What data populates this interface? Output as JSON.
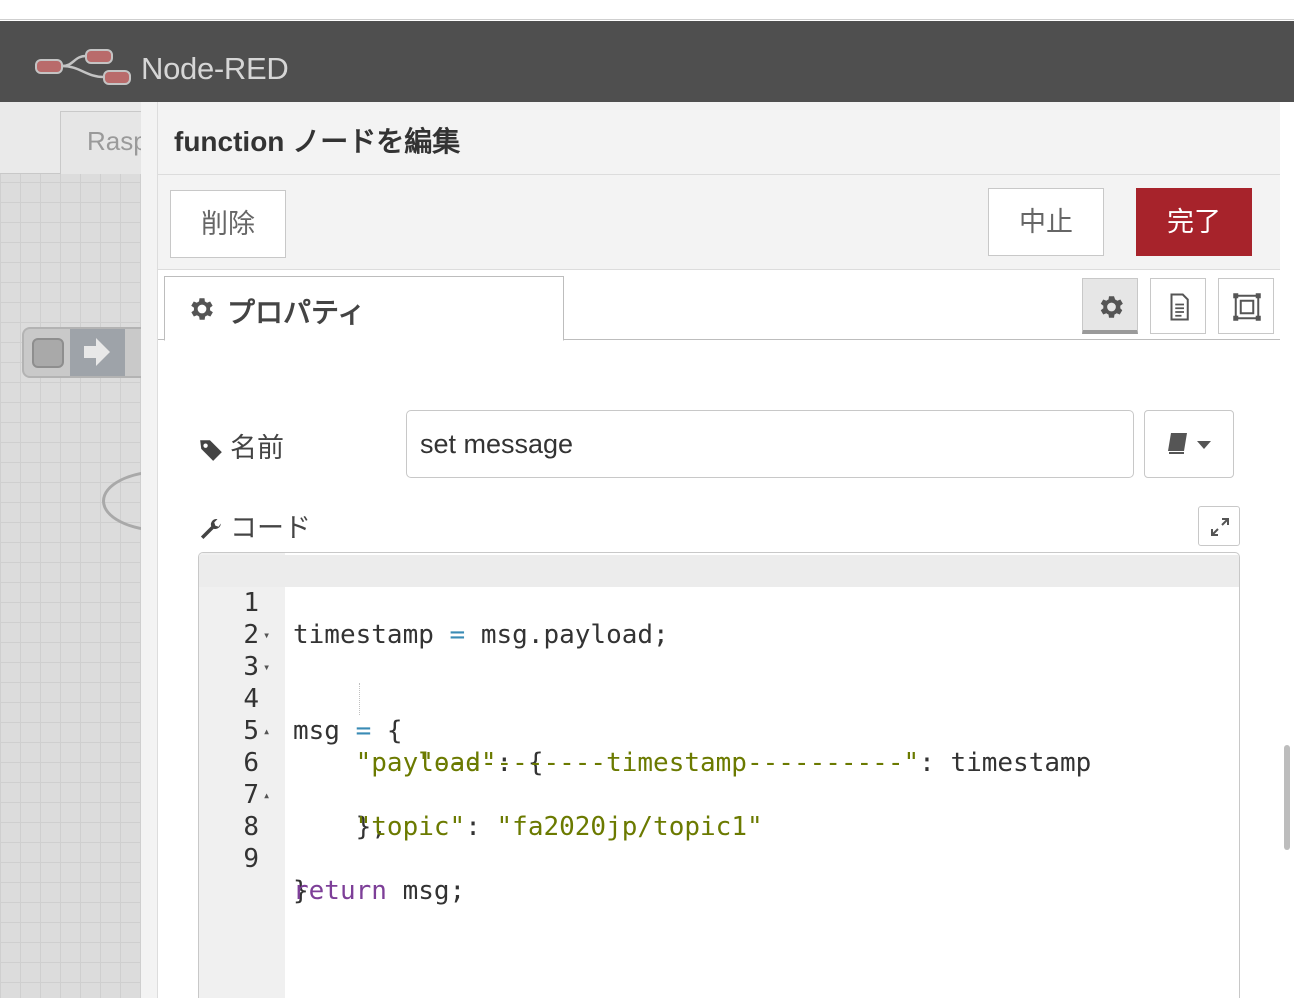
{
  "header": {
    "brand": "Node-RED"
  },
  "workspace": {
    "tab_label": "Rasp"
  },
  "tray": {
    "title": "function ノードを編集",
    "buttons": {
      "delete": "削除",
      "cancel": "中止",
      "done": "完了"
    },
    "tabs": {
      "properties": "プロパティ"
    },
    "form": {
      "name_label": "名前",
      "name_value": "set message",
      "code_label": "コード"
    }
  },
  "code_lines": [
    {
      "num": "1",
      "text": "timestamp = msg.payload;"
    },
    {
      "num": "2",
      "text": ""
    },
    {
      "num": "3",
      "text": "msg = {"
    },
    {
      "num": "4",
      "text": "    \"payload\": {"
    },
    {
      "num": "5",
      "text": "        \"-----------timestamp----------\": timestamp"
    },
    {
      "num": "6",
      "text": "    },"
    },
    {
      "num": "7",
      "text": "    \"topic\": \"fa2020jp/topic1\""
    },
    {
      "num": "8",
      "text": "}"
    },
    {
      "num": "9",
      "text": "return msg;"
    }
  ],
  "colors": {
    "header_bg": "#4f4f4f",
    "done_button": "#a7232b",
    "string": "#6b7a00",
    "keyword": "#7d3f98",
    "operator": "#3a8bb5"
  }
}
